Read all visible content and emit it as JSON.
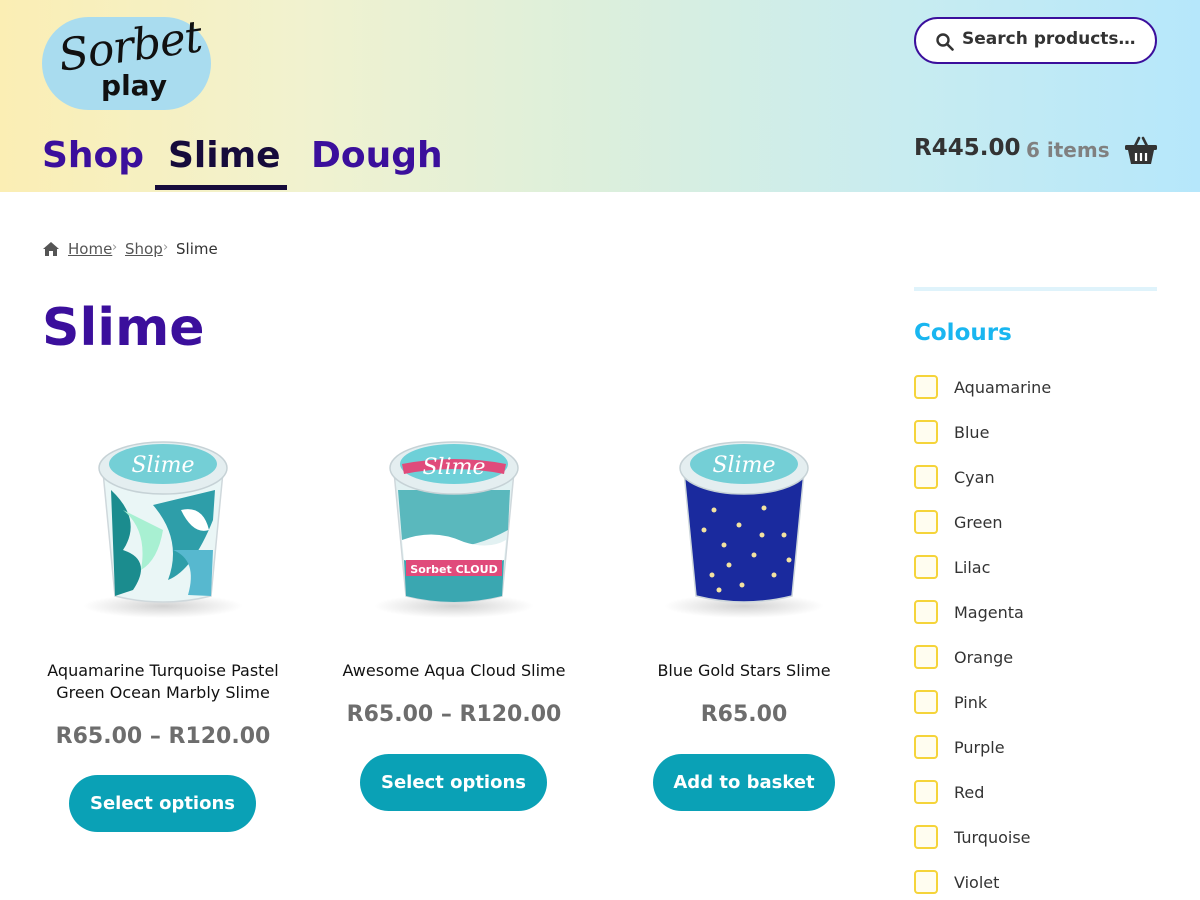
{
  "brand": {
    "logo_script": "Sorbet",
    "logo_sub": "play"
  },
  "nav": {
    "items": [
      "Shop",
      "Slime",
      "Dough"
    ],
    "active": "Slime"
  },
  "search": {
    "placeholder": "Search products…"
  },
  "cart": {
    "total": "R445.00",
    "count": "6 items"
  },
  "breadcrumb": {
    "items": [
      "Home",
      "Shop"
    ],
    "current": "Slime",
    "separator": "›"
  },
  "page": {
    "title": "Slime"
  },
  "products": [
    {
      "name": "Aquamarine Turquoise Pastel Green Ocean Marbly Slime",
      "price": "R65.00 – R120.00",
      "button": "Select options"
    },
    {
      "name": "Awesome Aqua Cloud Slime",
      "price": "R65.00 – R120.00",
      "button": "Select options"
    },
    {
      "name": "Blue Gold Stars Slime",
      "price": "R65.00",
      "button": "Add to basket"
    }
  ],
  "sidebar": {
    "title": "Colours",
    "filters": [
      "Aquamarine",
      "Blue",
      "Cyan",
      "Green",
      "Lilac",
      "Magenta",
      "Orange",
      "Pink",
      "Purple",
      "Red",
      "Turquoise",
      "Violet"
    ]
  },
  "colors": {
    "brand_purple": "#3b0f9c",
    "button_teal": "#0aa1b6",
    "sidebar_title": "#19b6f0",
    "checkbox_border": "#f5d43a"
  }
}
